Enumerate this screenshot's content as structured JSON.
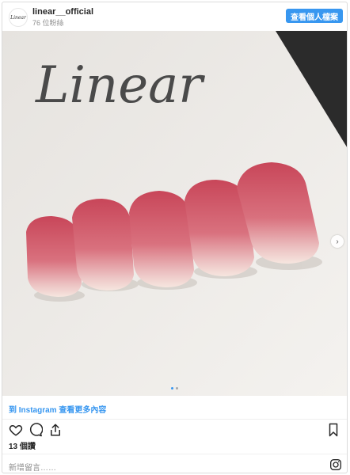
{
  "header": {
    "avatar_text": "Linear",
    "username": "linear__official",
    "followers": "76 位粉絲",
    "profile_button": "查看個人檔案"
  },
  "post": {
    "photo_logo_text": "Linear",
    "carousel_dots": 2,
    "carousel_active": 0,
    "more_link": "到 Instagram 查看更多內容",
    "likes": "13 個讚",
    "comment_placeholder": "新增留言……"
  },
  "icons": {
    "like": "heart-icon",
    "comment": "comment-icon",
    "share": "share-icon",
    "save": "bookmark-icon",
    "next": "chevron-right-icon",
    "brand": "instagram-icon"
  },
  "colors": {
    "accent": "#3897f0",
    "nail_top": "#c94a5c",
    "nail_tip": "#f3dcd6"
  }
}
